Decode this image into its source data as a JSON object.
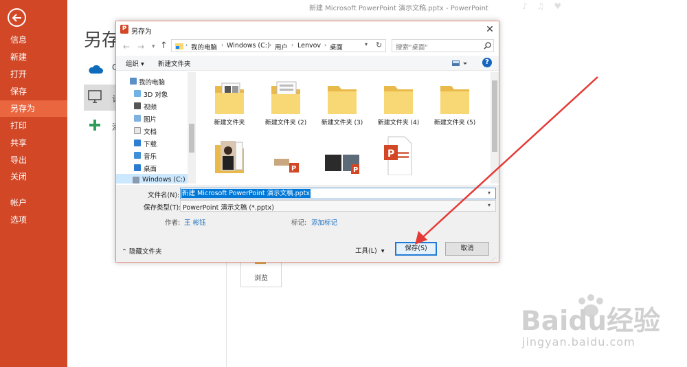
{
  "window_title": "新建 Microsoft PowerPoint 演示文稿.pptx - PowerPoint",
  "backstage": {
    "title": "另存",
    "nav": [
      {
        "label": "信息"
      },
      {
        "label": "新建"
      },
      {
        "label": "打开"
      },
      {
        "label": "保存"
      },
      {
        "label": "另存为",
        "active": true
      },
      {
        "label": "打印"
      },
      {
        "label": "共享"
      },
      {
        "label": "导出"
      },
      {
        "label": "关闭"
      },
      {
        "label": "帐户"
      },
      {
        "label": "选项"
      }
    ],
    "places": {
      "onedrive": "O",
      "computer": "计",
      "add": "添"
    },
    "browse_label": "浏览"
  },
  "dialog": {
    "title": "另存为",
    "breadcrumbs": [
      "我的电脑",
      "Windows (C:)",
      "用户",
      "Lenvov",
      "桌面"
    ],
    "search_placeholder": "搜索\"桌面\"",
    "toolbar": {
      "organize": "组织 ▾",
      "new_folder": "新建文件夹"
    },
    "nav_tree": [
      {
        "label": "我的电脑",
        "icon": "computer-icon"
      },
      {
        "label": "3D 对象",
        "icon": "3d-objects-icon"
      },
      {
        "label": "视频",
        "icon": "video-icon"
      },
      {
        "label": "图片",
        "icon": "pictures-icon"
      },
      {
        "label": "文档",
        "icon": "documents-icon"
      },
      {
        "label": "下载",
        "icon": "downloads-icon"
      },
      {
        "label": "音乐",
        "icon": "music-icon"
      },
      {
        "label": "桌面",
        "icon": "desktop-icon"
      },
      {
        "label": "Windows (C:)",
        "icon": "drive-icon",
        "selected": true
      }
    ],
    "files": [
      {
        "label": "新建文件夹",
        "type": "folder-docs"
      },
      {
        "label": "新建文件夹 (2)",
        "type": "folder-docs"
      },
      {
        "label": "新建文件夹 (3)",
        "type": "folder"
      },
      {
        "label": "新建文件夹 (4)",
        "type": "folder"
      },
      {
        "label": "新建文件夹 (5)",
        "type": "folder"
      },
      {
        "label": "",
        "type": "folder-photo"
      },
      {
        "label": "",
        "type": "pptx-thumb-a"
      },
      {
        "label": "",
        "type": "pptx-thumb-b"
      },
      {
        "label": "",
        "type": "pptx-file"
      }
    ],
    "filename_label": "文件名(N):",
    "filename_value": "新建 Microsoft PowerPoint 演示文稿.pptx",
    "filetype_label": "保存类型(T):",
    "filetype_value": "PowerPoint 演示文稿 (*.pptx)",
    "author_label": "作者:",
    "author_value": "王 彬钰",
    "tags_label": "标记:",
    "tags_value": "添加标记",
    "hide_folders": "隐藏文件夹",
    "tools": "工具(L)",
    "save": "保存(S)",
    "cancel": "取消"
  },
  "watermark": {
    "logo": "Baidu经验",
    "url": "jingyan.baidu.com"
  },
  "colors": {
    "accent": "#d24726",
    "accent_active": "#e9663f",
    "folder": "#f8d775",
    "link": "#1a6fc2",
    "arrow": "#e53935"
  }
}
